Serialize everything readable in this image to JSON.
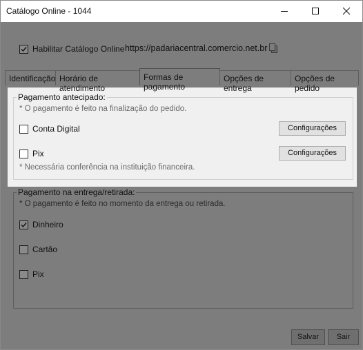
{
  "window": {
    "title": "Catálogo Online - 1044"
  },
  "catalog": {
    "enable_label": "Habilitar Catálogo Online",
    "enabled": true,
    "url": "https://padariacentral.comercio.net.br"
  },
  "tabs": [
    {
      "label": "Identificação",
      "selected": false
    },
    {
      "label": "Horário de atendimento",
      "selected": false
    },
    {
      "label": "Formas de pagamento",
      "selected": true
    },
    {
      "label": "Opções de entrega",
      "selected": false
    },
    {
      "label": "Opções de pedido",
      "selected": false
    }
  ],
  "prepaid": {
    "title": "Pagamento antecipado:",
    "note": "* O pagamento é feito na finalização do pedido.",
    "options": [
      {
        "label": "Conta Digital",
        "checked": false,
        "config_label": "Configurações"
      },
      {
        "label": "Pix",
        "checked": false,
        "config_label": "Configurações"
      }
    ],
    "footnote": "* Necessária conferência na instituição financeira."
  },
  "on_delivery": {
    "title": "Pagamento na entrega/retirada:",
    "note": "* O pagamento é feito no momento da entrega ou retirada.",
    "options": [
      {
        "label": "Dinheiro",
        "checked": true
      },
      {
        "label": "Cartão",
        "checked": false
      },
      {
        "label": "Pix",
        "checked": false
      }
    ]
  },
  "footer": {
    "save_label": "Salvar",
    "exit_label": "Sair"
  }
}
